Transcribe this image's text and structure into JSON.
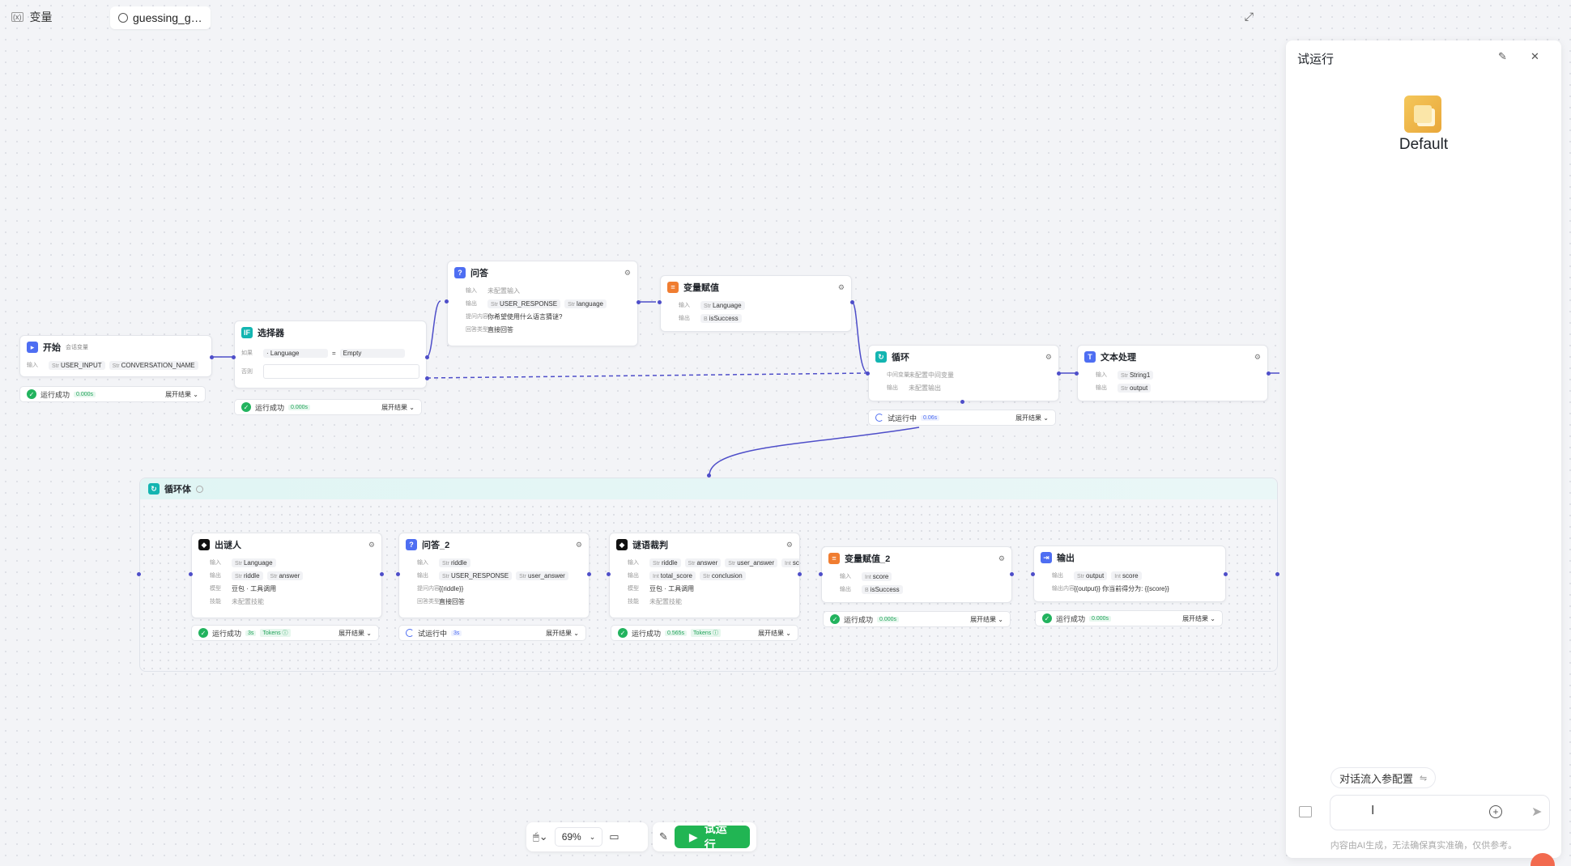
{
  "topbar": {
    "variables_label": "变量",
    "workflow_tab": "guessing_g…"
  },
  "nodes": {
    "start": {
      "title": "开始",
      "tag": "会话变量",
      "in_label": "输入",
      "vars": [
        "USER_INPUT",
        "CONVERSATION_NAME"
      ],
      "status": "运行成功",
      "time": "0.000s",
      "expand": "展开结果"
    },
    "selector": {
      "title": "选择器",
      "cond_label": "如果",
      "var": "Language",
      "op": "=",
      "value": "Empty",
      "else_label": "否则",
      "status": "运行成功",
      "time": "0.000s",
      "expand": "展开结果"
    },
    "qa": {
      "title": "问答",
      "in_label": "输入",
      "in_value": "未配置输入",
      "out_label": "输出",
      "out": [
        "USER_RESPONSE",
        "language"
      ],
      "q_label": "提问内容",
      "q_value": "你希望使用什么语言猜谜?",
      "type_label": "回答类型",
      "type_value": "直接回答"
    },
    "assign": {
      "title": "变量赋值",
      "in_label": "输入",
      "in_var": "Language",
      "out_label": "输出",
      "out_var": "isSuccess"
    },
    "loop": {
      "title": "循环",
      "l1_label": "中间变量",
      "l1_value": "未配置中间变量",
      "l2_label": "输出",
      "l2_value": "未配置输出",
      "status": "试运行中",
      "time": "0.06s",
      "expand": "展开结果"
    },
    "text": {
      "title": "文本处理",
      "in_label": "输入",
      "in_var": "String1",
      "out_label": "输出",
      "out_var": "output"
    }
  },
  "loop_body": {
    "title": "循环体",
    "riddler": {
      "title": "出谜人",
      "in_label": "输入",
      "in_var": "Language",
      "out_label": "输出",
      "out": [
        "riddle",
        "answer"
      ],
      "model_label": "模型",
      "model": "豆包 · 工具调用",
      "skill_label": "技能",
      "skill": "未配置技能",
      "status": "运行成功",
      "time": "3s",
      "tokens": "Tokens ⓘ",
      "expand": "展开结果"
    },
    "qa2": {
      "title": "问答_2",
      "in_label": "输入",
      "in_var": "riddle",
      "out_label": "输出",
      "out": [
        "USER_RESPONSE",
        "user_answer"
      ],
      "q_label": "提问内容",
      "q_value": "{{riddle}}",
      "type_label": "回答类型",
      "type_value": "直接回答",
      "status": "试运行中",
      "time": "3s",
      "expand": "展开结果"
    },
    "judge": {
      "title": "谜语裁判",
      "in_label": "输入",
      "in": [
        "riddle",
        "answer",
        "user_answer",
        "score"
      ],
      "out_label": "输出",
      "out": [
        "total_score",
        "conclusion"
      ],
      "model_label": "模型",
      "model": "豆包 · 工具调用",
      "skill_label": "技能",
      "skill": "未配置技能",
      "status": "运行成功",
      "time": "0.565s",
      "tokens": "Tokens ⓘ",
      "expand": "展开结果"
    },
    "assign2": {
      "title": "变量赋值_2",
      "in_label": "输入",
      "in_var": "score",
      "out_label": "输出",
      "out_var": "isSuccess",
      "status": "运行成功",
      "time": "0.000s",
      "expand": "展开结果"
    },
    "output": {
      "title": "输出",
      "in_label": "输出",
      "vars": [
        "output",
        "score"
      ],
      "content_label": "输出内容",
      "content": "{{output}} 你当前得分为: {{score}}",
      "status": "运行成功",
      "time": "0.000s",
      "expand": "展开结果"
    }
  },
  "panel": {
    "title": "试运行",
    "bot_name": "Default",
    "conv_config": "对话流入参配置",
    "disclaimer": "内容由AI生成，无法确保真实准确，仅供参考。"
  },
  "toolbar": {
    "zoom": "69%",
    "run_label": "试运行"
  },
  "colors": {
    "accent": "#4e4ec9",
    "success": "#22b35e",
    "run_button": "#21b553",
    "loop_teal": "#13b5b1"
  },
  "icons": [
    "variable-icon",
    "clock-icon",
    "expand-icon",
    "gear-icon",
    "mouse-icon",
    "minimap-icon",
    "pen-icon",
    "play-icon",
    "plus-icon",
    "send-icon",
    "broom-icon",
    "close-icon"
  ]
}
